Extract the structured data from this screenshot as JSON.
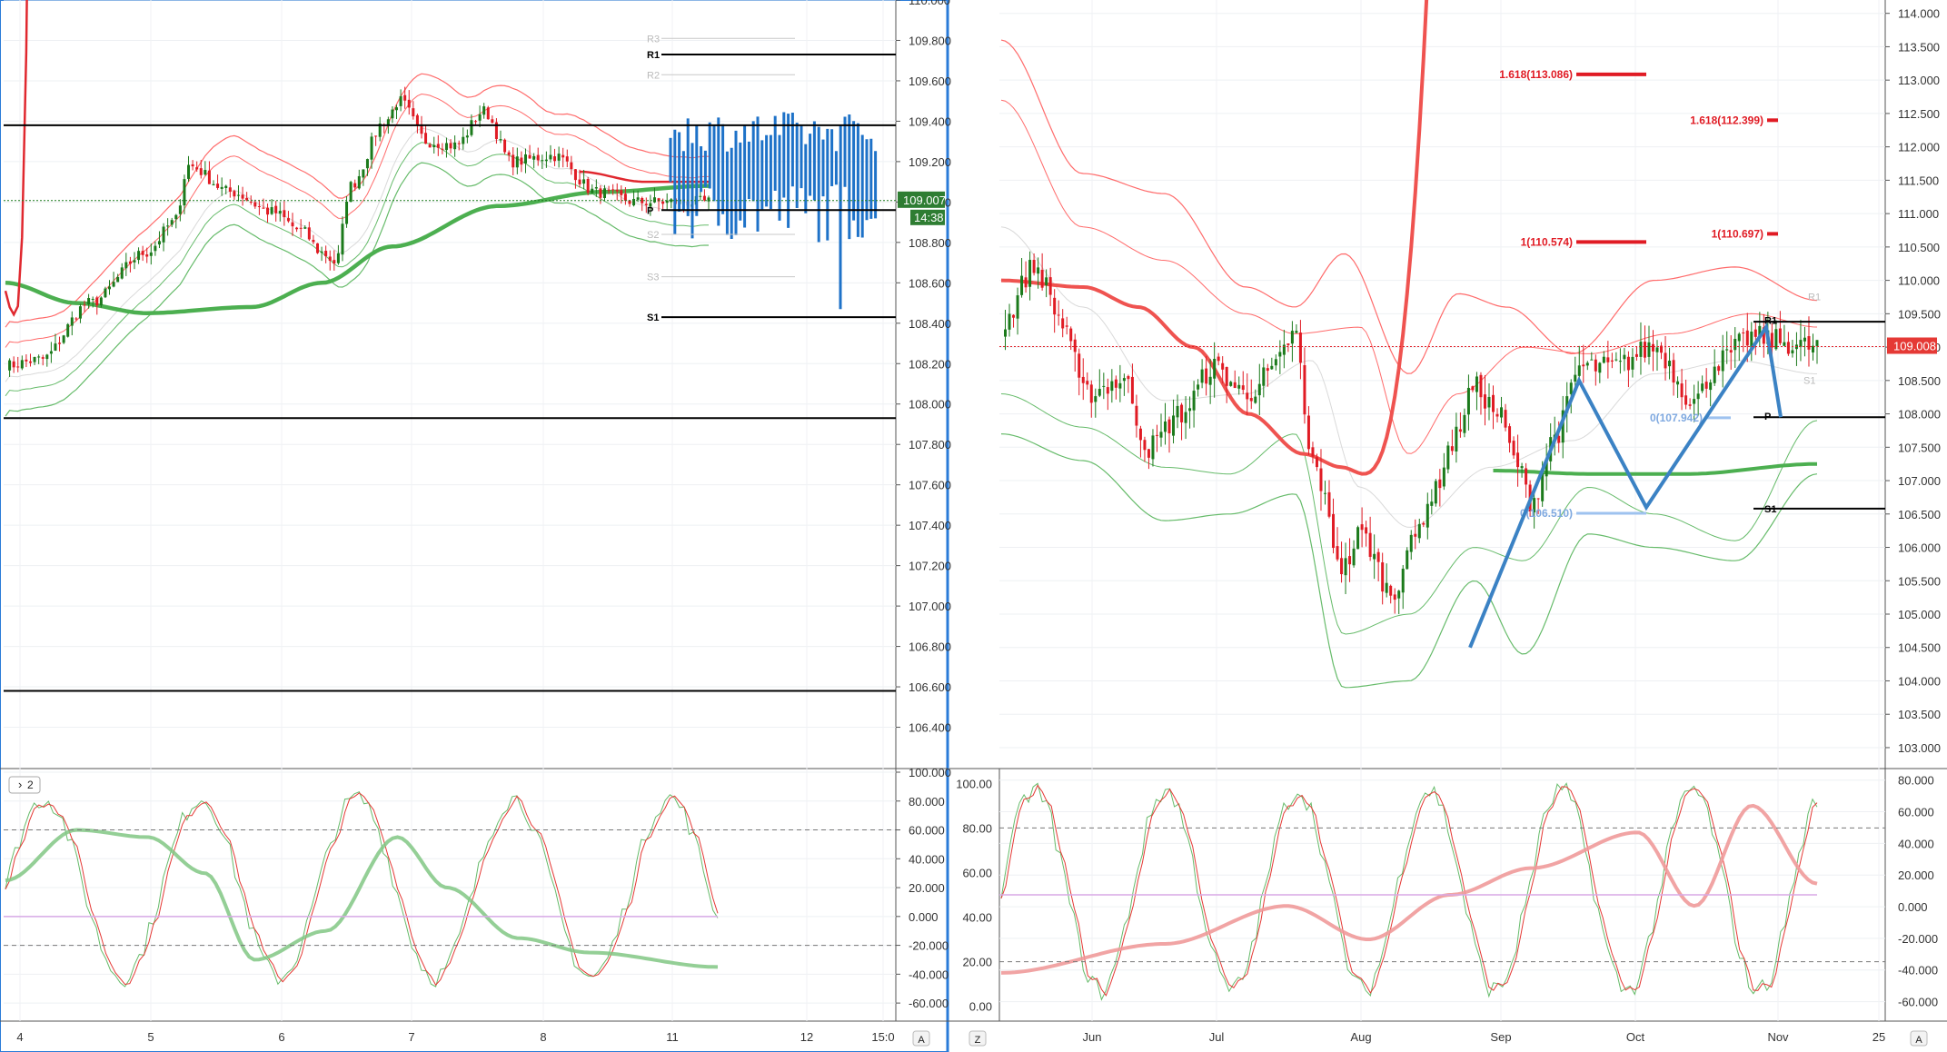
{
  "chart_data": [
    {
      "type": "candlestick",
      "panel": "left-price",
      "y_axis": {
        "ylim": [
          106.2,
          110.0
        ],
        "tick_labels": [
          "110.000",
          "109.800",
          "109.600",
          "109.400",
          "109.200",
          "109.000",
          "108.800",
          "108.600",
          "108.400",
          "108.200",
          "108.000",
          "107.800",
          "107.600",
          "107.400",
          "107.200",
          "107.000",
          "106.800",
          "106.600",
          "106.400"
        ]
      },
      "x_axis": {
        "tick_labels": [
          "4",
          "5",
          "6",
          "7",
          "8",
          "11",
          "12",
          "15:0"
        ]
      },
      "last_price_label": "109.007",
      "countdown_label": "14:38",
      "last_price": 109.007,
      "horizontal_levels": [
        109.38,
        107.93,
        106.58
      ],
      "pivot_levels": [
        {
          "label": "R3",
          "value": 109.81
        },
        {
          "label": "R1",
          "value": 109.73
        },
        {
          "label": "R2",
          "value": 109.63
        },
        {
          "label": "P",
          "value": 108.96
        },
        {
          "label": "S2",
          "value": 108.84
        },
        {
          "label": "S3",
          "value": 108.63
        },
        {
          "label": "S1",
          "value": 108.43
        }
      ],
      "colors": {
        "up": "#1b7a1b",
        "down": "#e01b24",
        "fast_ma": "#e0282f",
        "slow_ma": "#4caf50",
        "bands_upper": "#ff6b6b",
        "bands_lower": "#66bb6a",
        "projection": "#1e72c8"
      }
    },
    {
      "type": "line",
      "panel": "left-oscillator",
      "legend_badge": "2",
      "ylim": [
        -70,
        100
      ],
      "tick_labels": [
        "100.000",
        "80.000",
        "60.000",
        "40.000",
        "20.000",
        "0.000",
        "-20.000",
        "-40.000",
        "-60.000"
      ],
      "reference_lines": [
        60,
        0,
        -20
      ]
    },
    {
      "type": "candlestick",
      "panel": "right-price",
      "y_axis": {
        "ylim": [
          102.7,
          114.2
        ],
        "tick_labels": [
          "114.000",
          "113.500",
          "113.000",
          "112.500",
          "112.000",
          "111.500",
          "111.000",
          "110.500",
          "110.000",
          "109.500",
          "109.000",
          "108.500",
          "108.000",
          "107.500",
          "107.000",
          "106.500",
          "106.000",
          "105.500",
          "105.000",
          "104.500",
          "104.000",
          "103.500",
          "103.000"
        ]
      },
      "x_axis": {
        "tick_labels": [
          "Z",
          "Jun",
          "Jul",
          "Aug",
          "Sep",
          "Oct",
          "Nov",
          "25",
          "A"
        ]
      },
      "last_price_label": "109.008",
      "last_price": 109.008,
      "horizontal_levels": [
        109.38,
        107.95,
        106.58
      ],
      "fibonacci": [
        {
          "label": "1.618(113.086)",
          "value": 113.086
        },
        {
          "label": "1.618(112.399)",
          "value": 112.399
        },
        {
          "label": "1(110.574)",
          "value": 110.574
        },
        {
          "label": "1(110.697)",
          "value": 110.697
        },
        {
          "label": "0(107.942)",
          "value": 107.942
        },
        {
          "label": "0(106.510)",
          "value": 106.51
        }
      ],
      "pivot_labels": [
        "R1",
        "R1",
        "S1",
        "P",
        "S1"
      ],
      "zigzag": [
        [
          104.5,
          "Aug end"
        ],
        [
          108.5,
          "Sep mid"
        ],
        [
          106.6,
          "Oct start"
        ],
        [
          109.3,
          "Oct end"
        ],
        [
          107.95,
          "Nov start"
        ]
      ]
    },
    {
      "type": "line",
      "panel": "right-oscillator",
      "left_axis": {
        "ylim": [
          -5,
          105
        ],
        "tick_labels": [
          "100.00",
          "80.00",
          "60.00",
          "40.00",
          "20.00",
          "0.00"
        ]
      },
      "right_axis": {
        "tick_labels": [
          "80.000",
          "60.000",
          "40.000",
          "20.000",
          "0.000",
          "-20.000",
          "-40.000",
          "-60.000"
        ]
      },
      "reference_lines": [
        80,
        50,
        20
      ]
    }
  ],
  "footer": {
    "left_badge": "A",
    "right_badge": "A",
    "right_left_badge": "Z"
  }
}
